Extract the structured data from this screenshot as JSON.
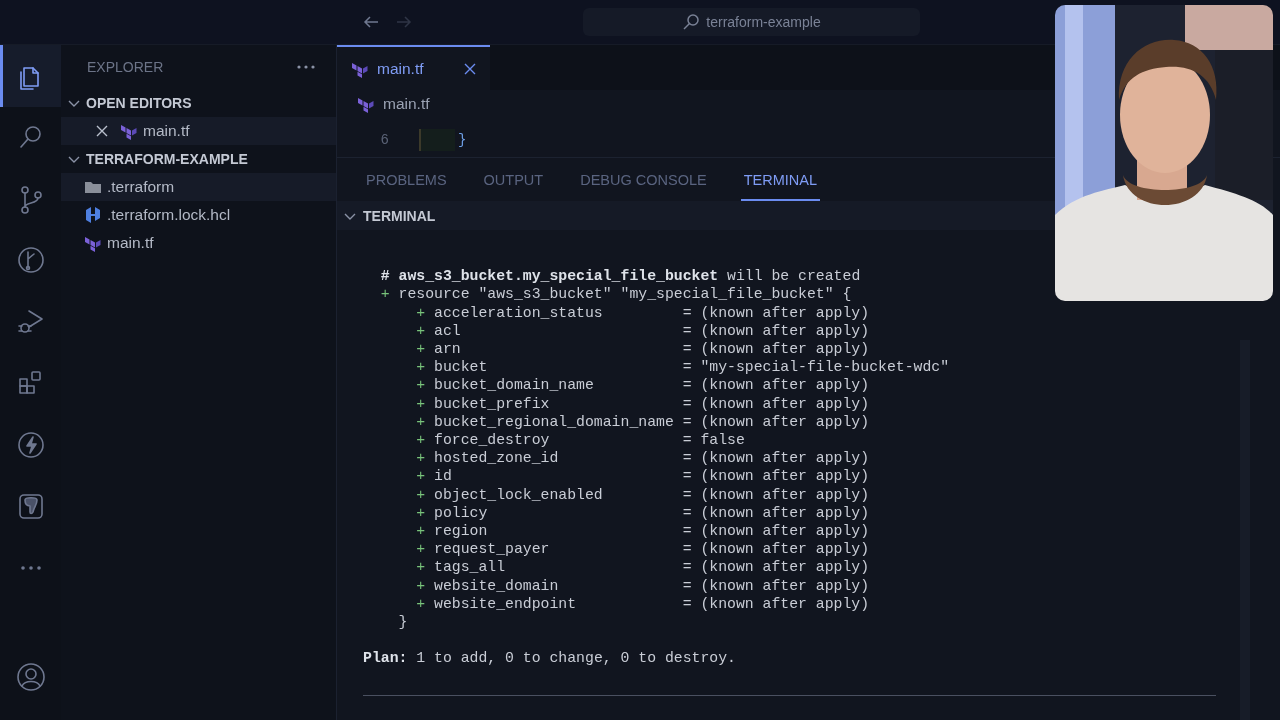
{
  "title_bar": {
    "back_enabled": true,
    "forward_enabled": false,
    "search": "terraform-example"
  },
  "activity_bar": {
    "items": [
      {
        "kind": "files",
        "selected": true
      },
      {
        "kind": "search",
        "selected": false
      },
      {
        "kind": "source-control",
        "selected": false
      },
      {
        "kind": "graph",
        "selected": false
      },
      {
        "kind": "debug",
        "selected": false
      },
      {
        "kind": "extensions",
        "selected": false
      },
      {
        "kind": "bolt",
        "selected": false
      },
      {
        "kind": "elephant",
        "selected": false
      },
      {
        "kind": "more",
        "selected": false
      }
    ],
    "bottom": [
      {
        "kind": "account",
        "selected": false
      }
    ]
  },
  "sidebar": {
    "title": "EXPLORER",
    "sections": [
      {
        "title": "OPEN EDITORS",
        "expanded": true,
        "items": [
          {
            "name": "main.tf",
            "kind": "terraform",
            "closable": true,
            "selected": true
          }
        ]
      },
      {
        "title": "TERRAFORM-EXAMPLE",
        "expanded": true,
        "items": [
          {
            "name": ".terraform",
            "kind": "folder",
            "closable": false,
            "selected": true
          },
          {
            "name": ".terraform.lock.hcl",
            "kind": "hcl",
            "closable": false,
            "selected": false
          },
          {
            "name": "main.tf",
            "kind": "terraform",
            "closable": false,
            "selected": false
          }
        ]
      }
    ]
  },
  "editor": {
    "tabs": [
      {
        "label": "main.tf",
        "kind": "terraform",
        "selected": true
      }
    ],
    "breadcrumb": "main.tf",
    "lines": [
      {
        "number": "6",
        "code": "}"
      }
    ]
  },
  "panel": {
    "tabs": [
      {
        "label": "PROBLEMS",
        "selected": false
      },
      {
        "label": "OUTPUT",
        "selected": false
      },
      {
        "label": "DEBUG CONSOLE",
        "selected": false
      },
      {
        "label": "TERMINAL",
        "selected": true
      }
    ],
    "section": {
      "title": "TERMINAL",
      "expanded": true
    },
    "terminal": {
      "lines": [
        {
          "kind": "blank"
        },
        {
          "kind": "heading",
          "text": "**# aws_s3_bucket.my_special_file_bucket** will be created"
        },
        {
          "kind": "resource",
          "marker": "+",
          "text": "resource \"aws_s3_bucket\" \"my_special_file_bucket\" {"
        },
        {
          "kind": "attribute",
          "marker": "+",
          "name": "acceleration_status",
          "value": "= (known after apply)"
        },
        {
          "kind": "attribute",
          "marker": "+",
          "name": "acl",
          "value": "= (known after apply)"
        },
        {
          "kind": "attribute",
          "marker": "+",
          "name": "arn",
          "value": "= (known after apply)"
        },
        {
          "kind": "attribute",
          "marker": "+",
          "name": "bucket",
          "value": "= \"my-special-file-bucket-wdc\""
        },
        {
          "kind": "attribute",
          "marker": "+",
          "name": "bucket_domain_name",
          "value": "= (known after apply)"
        },
        {
          "kind": "attribute",
          "marker": "+",
          "name": "bucket_prefix",
          "value": "= (known after apply)"
        },
        {
          "kind": "attribute",
          "marker": "+",
          "name": "bucket_regional_domain_name",
          "value": "= (known after apply)"
        },
        {
          "kind": "attribute",
          "marker": "+",
          "name": "force_destroy",
          "value": "= false"
        },
        {
          "kind": "attribute",
          "marker": "+",
          "name": "hosted_zone_id",
          "value": "= (known after apply)"
        },
        {
          "kind": "attribute",
          "marker": "+",
          "name": "id",
          "value": "= (known after apply)"
        },
        {
          "kind": "attribute",
          "marker": "+",
          "name": "object_lock_enabled",
          "value": "= (known after apply)"
        },
        {
          "kind": "attribute",
          "marker": "+",
          "name": "policy",
          "value": "= (known after apply)"
        },
        {
          "kind": "attribute",
          "marker": "+",
          "name": "region",
          "value": "= (known after apply)"
        },
        {
          "kind": "attribute",
          "marker": "+",
          "name": "request_payer",
          "value": "= (known after apply)"
        },
        {
          "kind": "attribute",
          "marker": "+",
          "name": "tags_all",
          "value": "= (known after apply)"
        },
        {
          "kind": "attribute",
          "marker": "+",
          "name": "website_domain",
          "value": "= (known after apply)"
        },
        {
          "kind": "attribute",
          "marker": "+",
          "name": "website_endpoint",
          "value": "= (known after apply)"
        },
        {
          "kind": "close",
          "text": "}"
        },
        {
          "kind": "blank"
        },
        {
          "kind": "summary",
          "text": "**Plan:** 1 to add, 0 to change, 0 to destroy."
        },
        {
          "kind": "blank"
        },
        {
          "kind": "rule"
        }
      ]
    }
  }
}
